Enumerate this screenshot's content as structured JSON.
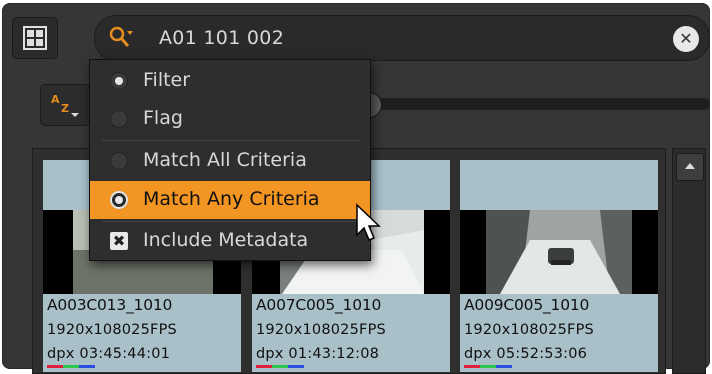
{
  "search": {
    "value": "A01 101 002"
  },
  "menu": {
    "items": [
      {
        "label": "Filter",
        "type": "radio",
        "selected": true
      },
      {
        "label": "Flag",
        "type": "radio",
        "selected": false
      },
      {
        "label": "Match All Criteria",
        "type": "radio",
        "selected": false
      },
      {
        "label": "Match Any Criteria",
        "type": "radio",
        "selected": true,
        "highlighted": true
      },
      {
        "label": "Include Metadata",
        "type": "checkbox",
        "checked": true
      }
    ]
  },
  "sort": {
    "label_top": "A",
    "label_bottom": "Z"
  },
  "clips": [
    {
      "name": "A003C013_1010",
      "resolution": "1920x108025FPS",
      "format": "dpx",
      "timecode": "03:45:44:01"
    },
    {
      "name": "A007C005_1010",
      "resolution": "1920x108025FPS",
      "format": "dpx",
      "timecode": "01:43:12:08"
    },
    {
      "name": "A009C005_1010",
      "resolution": "1920x108025FPS",
      "format": "dpx",
      "timecode": "05:52:53:06"
    }
  ],
  "colors": {
    "accent": "#f39523",
    "panel": "#363636",
    "tile": "#a9c0c9",
    "rgb_red": "#e0203a",
    "rgb_green": "#2ec84a",
    "rgb_blue": "#2a4ee0"
  },
  "icons": {
    "view": "grid-view-icon",
    "search": "search-options-icon",
    "clear": "clear-icon",
    "sort": "sort-az-icon",
    "scroll": "scroll-up-icon",
    "cursor": "mouse-cursor-icon"
  }
}
